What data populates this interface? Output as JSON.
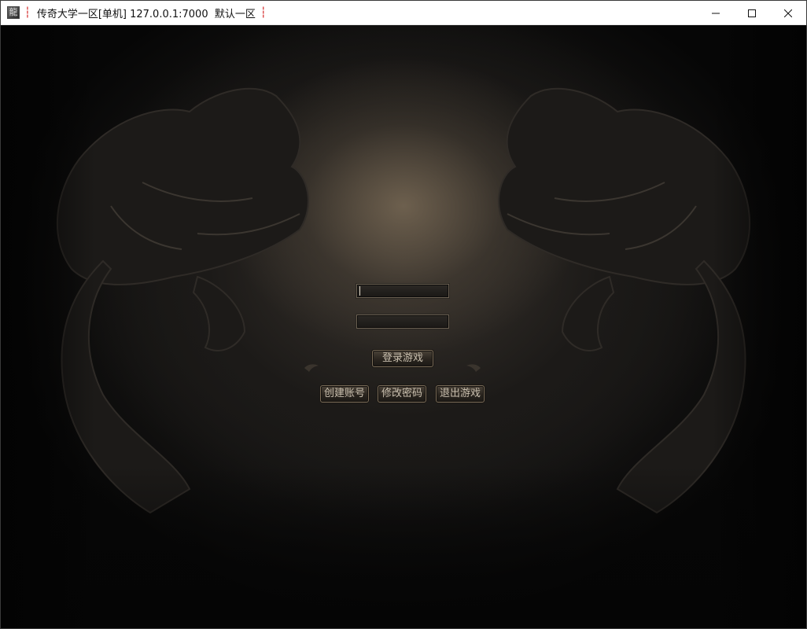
{
  "window": {
    "title": "传奇大学一区[单机] 127.0.0.1:7000  默认一区",
    "icon_glyph": "龍",
    "title_separator": "┆",
    "controls": [
      "minimize-icon",
      "maximize-icon",
      "close-icon"
    ]
  },
  "login": {
    "account_value": "",
    "password_value": "",
    "login_label": "登录游戏",
    "create_account_label": "创建账号",
    "change_password_label": "修改密码",
    "exit_label": "退出游戏"
  },
  "colors": {
    "background": "#050505",
    "button_text": "#c9bfae",
    "button_border": "#7a6c58"
  }
}
